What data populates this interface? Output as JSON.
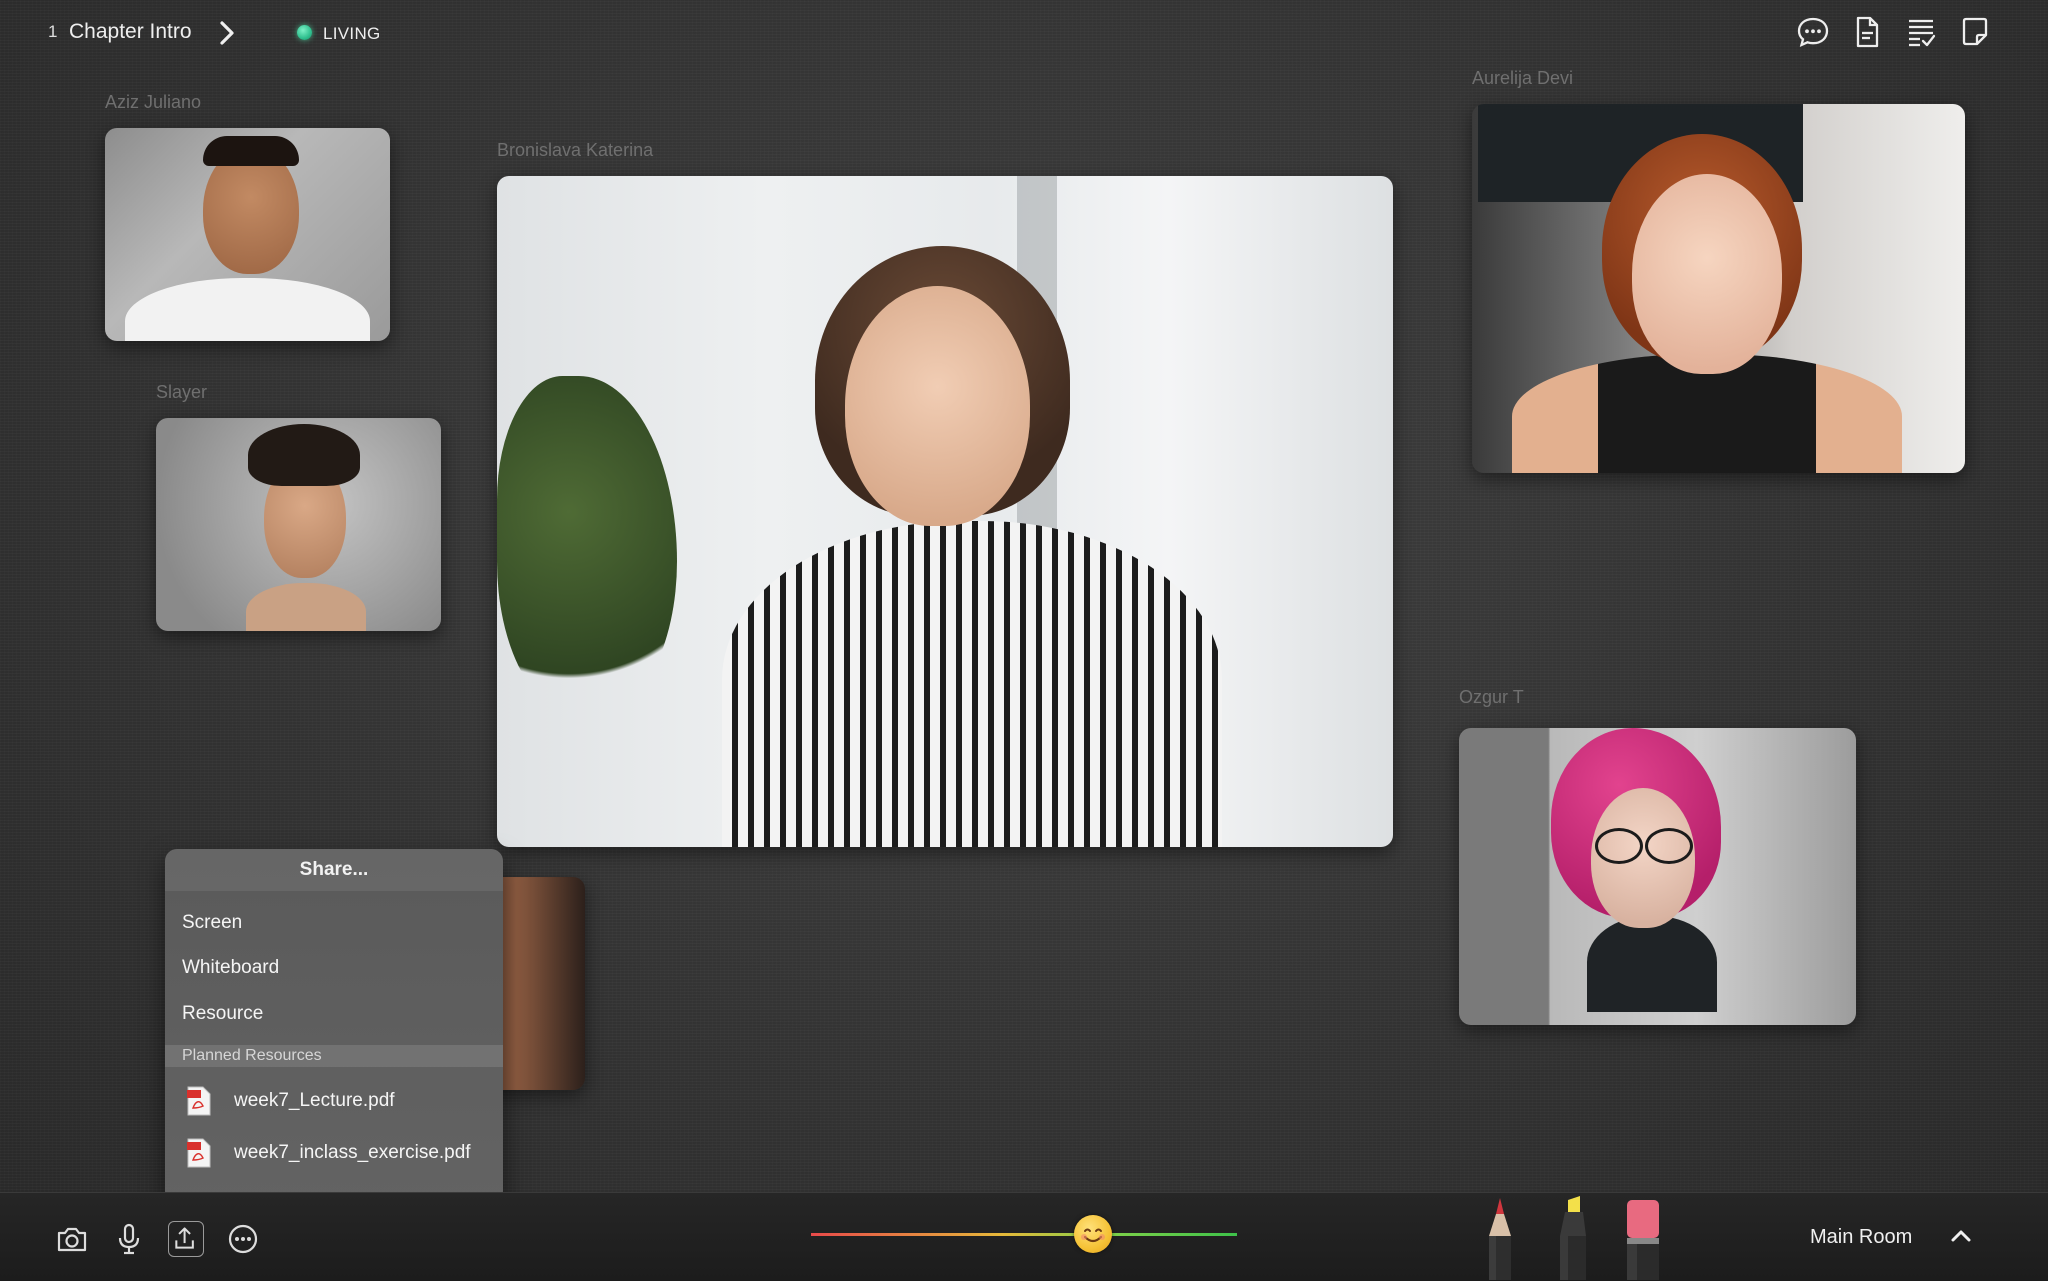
{
  "topbar": {
    "chapter_number": "1",
    "chapter_title": "Chapter Intro",
    "status_label": "LIVING"
  },
  "participants": {
    "aziz": "Aziz Juliano",
    "slayer": "Slayer",
    "bronislava": "Bronislava Katerina",
    "aurelija": "Aurelija Devi",
    "ozgur": "Ozgur T"
  },
  "share_menu": {
    "title": "Share...",
    "options": [
      "Screen",
      "Whiteboard",
      "Resource"
    ],
    "section_label": "Planned Resources",
    "files": [
      "week7_Lecture.pdf",
      "week7_inclass_exercise.pdf"
    ]
  },
  "bottombar": {
    "room_label": "Main Room",
    "mood_emoji": "😊"
  },
  "colors": {
    "live_dot": "#2fbf8e",
    "pen_red": "#d0363e",
    "highlighter_yellow": "#f3e04a",
    "eraser_pink": "#e86a80"
  }
}
